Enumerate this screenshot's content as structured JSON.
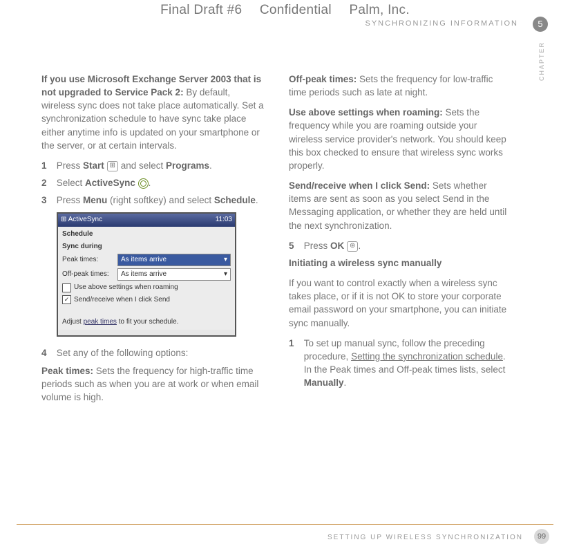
{
  "header": {
    "draft": "Final Draft #6",
    "confidential": "Confidential",
    "company": "Palm, Inc.",
    "sectionTitle": "SYNCHRONIZING INFORMATION",
    "chapterNum": "5",
    "chapterLabel": "CHAPTER"
  },
  "left": {
    "intro_bold": "If you use Microsoft Exchange Server 2003 that is not upgraded to Service Pack 2:",
    "intro_rest": " By default, wireless sync does not take place automatically. Set a synchronization schedule to have sync take place either anytime info is updated on your smartphone or the server, or at certain intervals.",
    "step1_num": "1",
    "step1_a": "Press ",
    "step1_b": "Start",
    "step1_c": " and select ",
    "step1_d": "Programs",
    "step1_e": ".",
    "step2_num": "2",
    "step2_a": "Select ",
    "step2_b": "ActiveSync",
    "step2_c": ".",
    "step3_num": "3",
    "step3_a": "Press ",
    "step3_b": "Menu",
    "step3_c": " (right softkey) and select ",
    "step3_d": "Schedule",
    "step3_e": ".",
    "ss": {
      "title": "ActiveSync",
      "clock": "11:03",
      "heading": "Schedule",
      "sync_during": "Sync during",
      "peak": "Peak times:",
      "peak_val": "As items arrive",
      "offpeak": "Off-peak times:",
      "offpeak_val": "As items arrive",
      "roaming": "Use above settings when roaming",
      "sendrcv": "Send/receive when I click Send",
      "adjust_a": "Adjust ",
      "adjust_link": "peak times",
      "adjust_b": " to fit your schedule."
    },
    "step4_num": "4",
    "step4": "Set any of the following options:",
    "peak_bold": "Peak times:",
    "peak_rest": " Sets the frequency for high-traffic time periods such as when you are at work or when email volume is high."
  },
  "right": {
    "offpeak_bold": "Off-peak times:",
    "offpeak_rest": " Sets the frequency for low-traffic time periods such as late at night.",
    "roaming_bold": "Use above settings when roaming:",
    "roaming_rest": " Sets the frequency while you are roaming outside your wireless service provider's network. You should keep this box checked to ensure that wireless sync works properly.",
    "send_bold": "Send/receive when I click Send:",
    "send_rest": " Sets whether items are sent as soon as you select Send in the Messaging application, or whether they are held until the next synchronization.",
    "step5_num": "5",
    "step5_a": "Press ",
    "step5_b": "OK",
    "step5_c": ".",
    "sec_title": "Initiating a wireless sync manually",
    "sec_intro": "If you want to control exactly when a wireless sync takes place, or if it is not OK to store your corporate email password on your smartphone, you can initiate sync manually.",
    "r1_num": "1",
    "r1_a": "To set up manual sync, follow the preceding procedure, ",
    "r1_link": "Setting the synchronization schedule",
    "r1_b": ". In the Peak times and Off-peak times lists, select ",
    "r1_c": "Manually",
    "r1_d": "."
  },
  "footer": {
    "text": "SETTING UP WIRELESS SYNCHRONIZATION",
    "page": "99"
  }
}
